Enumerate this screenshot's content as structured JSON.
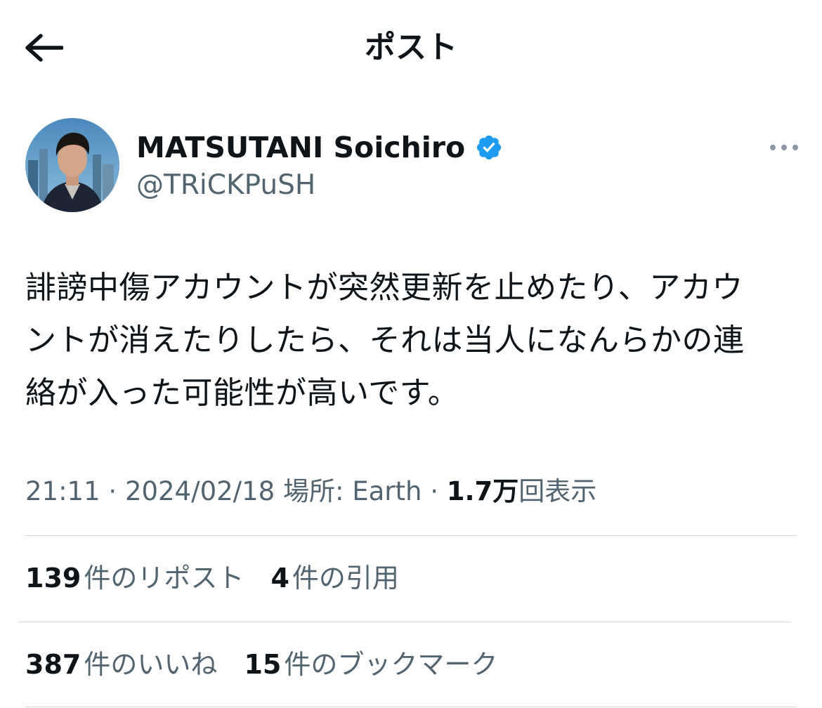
{
  "header": {
    "title": "ポスト",
    "back_icon": "arrow-left-icon"
  },
  "author": {
    "display_name": "MATSUTANI Soichiro",
    "handle": "@TRiCKPuSH",
    "verified": true,
    "verified_color": "#1d9bf0",
    "more_icon": "more-horizontal-icon"
  },
  "tweet": {
    "lines": [
      "誹謗中傷アカウントが突然更新を止めたり、アカウ",
      "ントが消えたりしたら、それは当人になんらかの連",
      "絡が入った可能性が高いです。"
    ]
  },
  "meta": {
    "time": "21:11",
    "separator": "·",
    "date": "2024/02/18",
    "location_label": "場所: Earth",
    "views_count": "1.7万",
    "views_label": "回表示"
  },
  "stats": {
    "reposts_count": "139",
    "reposts_label": "件のリポスト",
    "quotes_count": "4",
    "quotes_label": "件の引用",
    "likes_count": "387",
    "likes_label": "件のいいね",
    "bookmarks_count": "15",
    "bookmarks_label": "件のブックマーク"
  },
  "colors": {
    "text_primary": "#0f1419",
    "text_secondary": "#536471",
    "divider": "#cfd9de"
  }
}
